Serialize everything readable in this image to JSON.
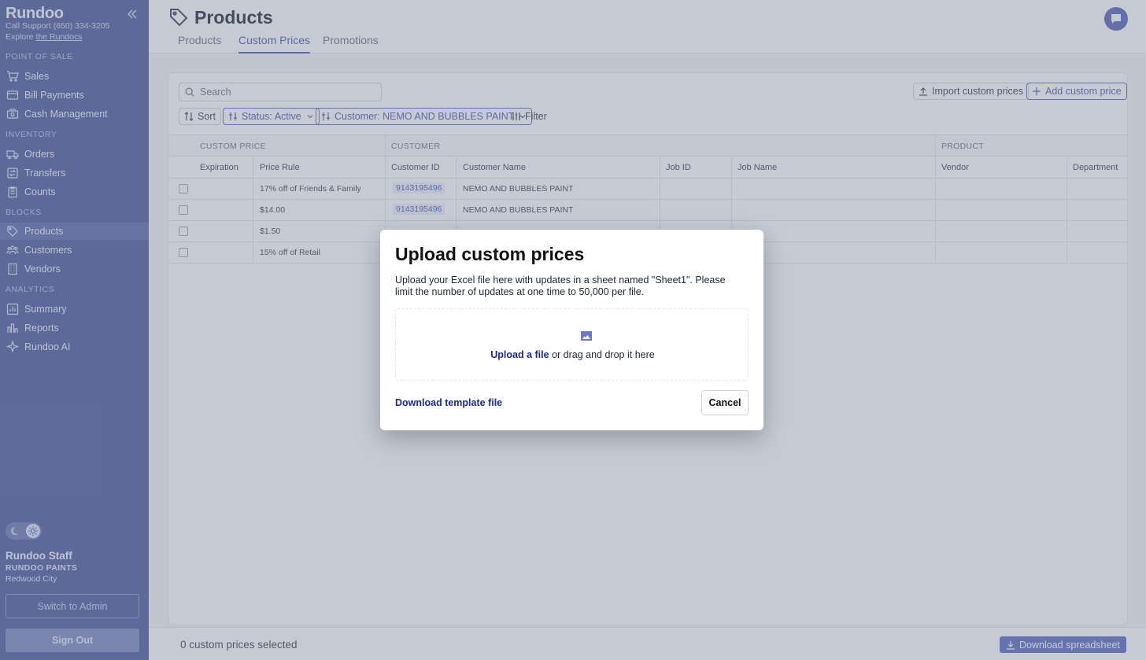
{
  "sidebar": {
    "brand": "Rundoo",
    "support": "Call Support (650) 334-3205",
    "explore_prefix": "Explore ",
    "explore_link": "the Rundocs",
    "sections": {
      "pos": "POINT OF SALE",
      "inventory": "INVENTORY",
      "blocks": "BLOCKS",
      "analytics": "ANALYTICS"
    },
    "items": {
      "sales": "Sales",
      "bill_payments": "Bill Payments",
      "cash_management": "Cash Management",
      "orders": "Orders",
      "transfers": "Transfers",
      "counts": "Counts",
      "products": "Products",
      "customers": "Customers",
      "vendors": "Vendors",
      "summary": "Summary",
      "reports": "Reports",
      "rundoo_ai": "Rundoo AI"
    },
    "user": {
      "name": "Rundoo Staff",
      "org": "RUNDOO PAINTS",
      "city": "Redwood City"
    },
    "switch_admin": "Switch to Admin",
    "sign_out": "Sign Out"
  },
  "header": {
    "title": "Products",
    "tabs": {
      "products": "Products",
      "custom_prices": "Custom Prices",
      "promotions": "Promotions"
    },
    "active_tab": "Custom Prices"
  },
  "toolbar": {
    "search_placeholder": "Search",
    "import": "Import custom prices",
    "add": "Add custom price",
    "sort": "Sort",
    "status_filter": "Status: Active",
    "customer_filter": "Customer: NEMO AND BUBBLES PAINT",
    "filter": "Filter"
  },
  "table": {
    "groups": {
      "custom_price": "CUSTOM PRICE",
      "customer": "CUSTOMER",
      "product": "PRODUCT"
    },
    "columns": {
      "expiration": "Expiration",
      "price_rule": "Price Rule",
      "customer_id": "Customer ID",
      "customer_name": "Customer Name",
      "job_id": "Job ID",
      "job_name": "Job Name",
      "vendor": "Vendor",
      "department": "Department"
    },
    "rows": [
      {
        "price_rule": "17% off of Friends & Family",
        "customer_id": "9143195496",
        "customer_name": "NEMO AND BUBBLES PAINT"
      },
      {
        "price_rule": "$14.00",
        "customer_id": "9143195496",
        "customer_name": "NEMO AND BUBBLES PAINT"
      },
      {
        "price_rule": "$1.50",
        "customer_id": "",
        "customer_name": ""
      },
      {
        "price_rule": "15% off of Retail",
        "customer_id": "",
        "customer_name": ""
      }
    ]
  },
  "footer": {
    "selected": "0 custom prices selected",
    "download": "Download spreadsheet"
  },
  "modal": {
    "title": "Upload custom prices",
    "description": "Upload your Excel file here with updates in a sheet named \"Sheet1\". Please limit the number of updates at one time to 50,000 per file.",
    "upload_link": "Upload a file",
    "drop_text": " or drag and drop it here",
    "download_template": "Download template file",
    "cancel": "Cancel"
  },
  "colors": {
    "sidebar_bg": "#4b5a9c",
    "accent": "#4b5ab0",
    "link_dark": "#1e2a8c"
  }
}
